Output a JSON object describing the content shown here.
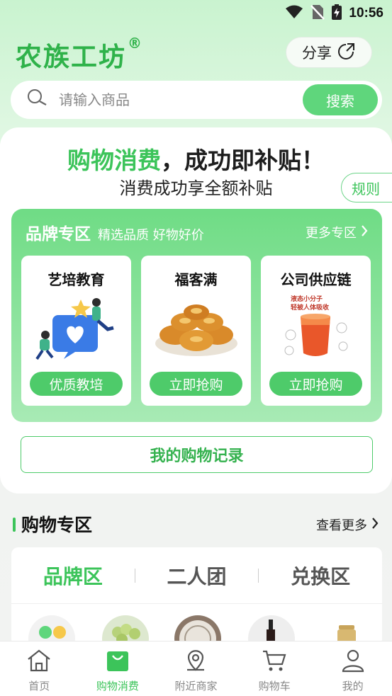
{
  "status_bar": {
    "time": "10:56"
  },
  "header": {
    "logo": "农族工坊",
    "logo_mark": "®",
    "share_label": "分享"
  },
  "search": {
    "placeholder": "请输入商品",
    "button": "搜索"
  },
  "promo": {
    "title_green": "购物消费",
    "title_dark": "，成功即补贴！",
    "subtitle": "消费成功享全额补贴",
    "rule_label": "规则"
  },
  "brand_zone": {
    "title": "品牌专区",
    "slogan": "精选品质 好物好价",
    "more": "更多专区",
    "cards": [
      {
        "name": "艺培教育",
        "button": "优质教培",
        "icon": "education-illustration"
      },
      {
        "name": "福客满",
        "button": "立即抢购",
        "icon": "pastry-image"
      },
      {
        "name": "公司供应链",
        "button": "立即抢购",
        "icon": "juice-image",
        "img_text": "液态小分子\n轻被人体吸收"
      }
    ]
  },
  "record_button": "我的购物记录",
  "shop_section": {
    "title": "购物专区",
    "more": "查看更多",
    "tabs": [
      "品牌区",
      "二人团",
      "兑换区"
    ],
    "active_tab": 0
  },
  "tabbar": {
    "items": [
      {
        "label": "首页",
        "icon": "home-icon"
      },
      {
        "label": "购物消费",
        "icon": "shopping-bag-icon"
      },
      {
        "label": "附近商家",
        "icon": "location-icon"
      },
      {
        "label": "购物车",
        "icon": "cart-icon"
      },
      {
        "label": "我的",
        "icon": "user-icon"
      }
    ],
    "active": 1
  },
  "colors": {
    "accent": "#3cc45a",
    "brand_green": "#2fb24a"
  }
}
